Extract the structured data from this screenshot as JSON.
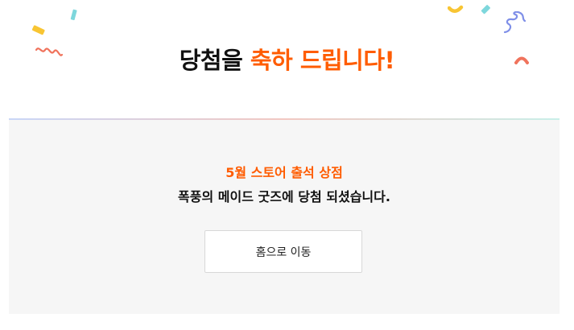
{
  "headline": {
    "part1": "당첨을 ",
    "accent": "축하 드립니다!"
  },
  "panel": {
    "store_title": "5월 스토어 출석 상점",
    "message": "폭풍의 메이드 굿즈에 당첨 되셨습니다.",
    "home_button_label": "홈으로 이동"
  },
  "colors": {
    "accent": "#ff5c00",
    "panel_bg": "#f6f6f6",
    "confetti_yellow": "#f8c533",
    "confetti_cyan": "#7ed7dc",
    "confetti_coral": "#f0735c",
    "confetti_blue": "#7f8fe8"
  },
  "icons": [
    "confetti-ribbon",
    "confetti-piece",
    "curly-streamer"
  ]
}
